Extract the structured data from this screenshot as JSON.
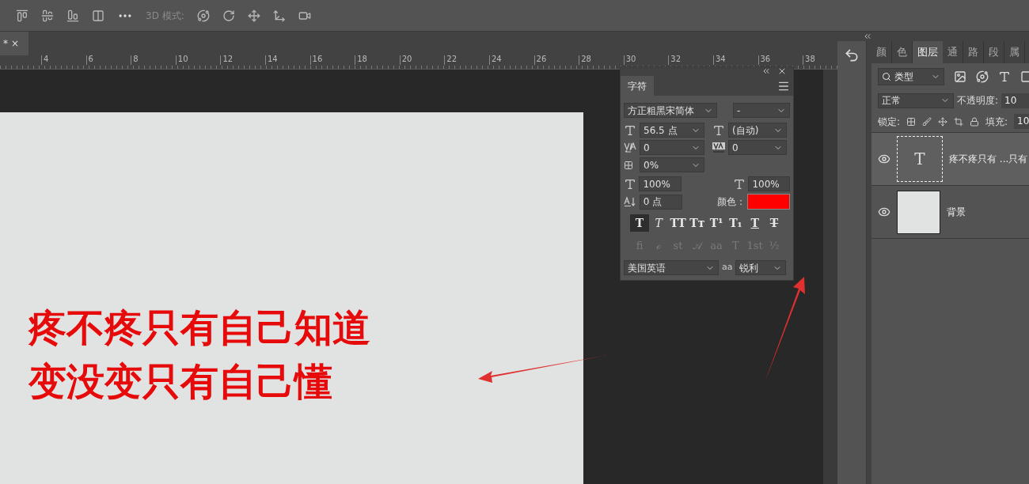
{
  "toolbar": {
    "mode_label": "3D 模式:"
  },
  "document_tab": {
    "label": "*",
    "close": "×"
  },
  "ruler": {
    "labels": [
      "4",
      "6",
      "8",
      "10",
      "12",
      "14",
      "16",
      "18",
      "20",
      "22",
      "24",
      "26",
      "28",
      "30",
      "32",
      "34",
      "36",
      "38"
    ]
  },
  "canvas": {
    "lines": [
      "疼不疼只有自己知道",
      "变没变只有自己懂"
    ]
  },
  "character_panel": {
    "title": "字符",
    "font_family": "方正粗黑宋简体",
    "font_style": "-",
    "size": "56.5 点",
    "leading": "(自动)",
    "kerning": "0",
    "tracking": "0",
    "tsume": "0%",
    "vertical_scale": "100%",
    "horizontal_scale": "100%",
    "baseline_shift": "0 点",
    "color_label": "颜色：",
    "color": "#ff0000",
    "style_buttons": [
      {
        "label": "T",
        "kind": "bold",
        "selected": true
      },
      {
        "label": "T",
        "kind": "italic",
        "selected": false
      },
      {
        "label": "TT",
        "kind": "caps",
        "selected": false
      },
      {
        "label": "Tт",
        "kind": "small",
        "selected": false
      },
      {
        "label": "T¹",
        "kind": "plain",
        "selected": false
      },
      {
        "label": "T₁",
        "kind": "plain",
        "selected": false
      },
      {
        "label": "T",
        "kind": "underline",
        "selected": false
      },
      {
        "label": "T",
        "kind": "strike",
        "selected": false
      }
    ],
    "opentype_buttons": [
      {
        "label": "fi",
        "disabled": true
      },
      {
        "label": "ℴ",
        "disabled": true
      },
      {
        "label": "st",
        "disabled": true
      },
      {
        "label": "𝒜",
        "disabled": true
      },
      {
        "label": "aa",
        "disabled": true
      },
      {
        "label": "T",
        "disabled": true
      },
      {
        "label": "1st",
        "disabled": true
      },
      {
        "label": "½",
        "disabled": true
      }
    ],
    "language": "美国英语",
    "antialias_label": "aa",
    "antialias": "锐利"
  },
  "layers_panel": {
    "tabs": [
      {
        "label": "颜",
        "selected": false
      },
      {
        "label": "色",
        "selected": false
      },
      {
        "label": "图层",
        "selected": true
      },
      {
        "label": "通",
        "selected": false
      },
      {
        "label": "路",
        "selected": false
      },
      {
        "label": "段",
        "selected": false
      },
      {
        "label": "属",
        "selected": false
      }
    ],
    "filter": "类型",
    "blend_mode": "正常",
    "opacity_label": "不透明度:",
    "opacity": "10",
    "lock_label": "锁定:",
    "fill_label": "填充:",
    "fill": "10",
    "layers": [
      {
        "kind": "text",
        "thumb_label": "T",
        "name": "疼不疼只有 ...只有",
        "visible": true,
        "selected": true
      },
      {
        "kind": "image",
        "name": "背景",
        "visible": true,
        "selected": false
      }
    ]
  }
}
